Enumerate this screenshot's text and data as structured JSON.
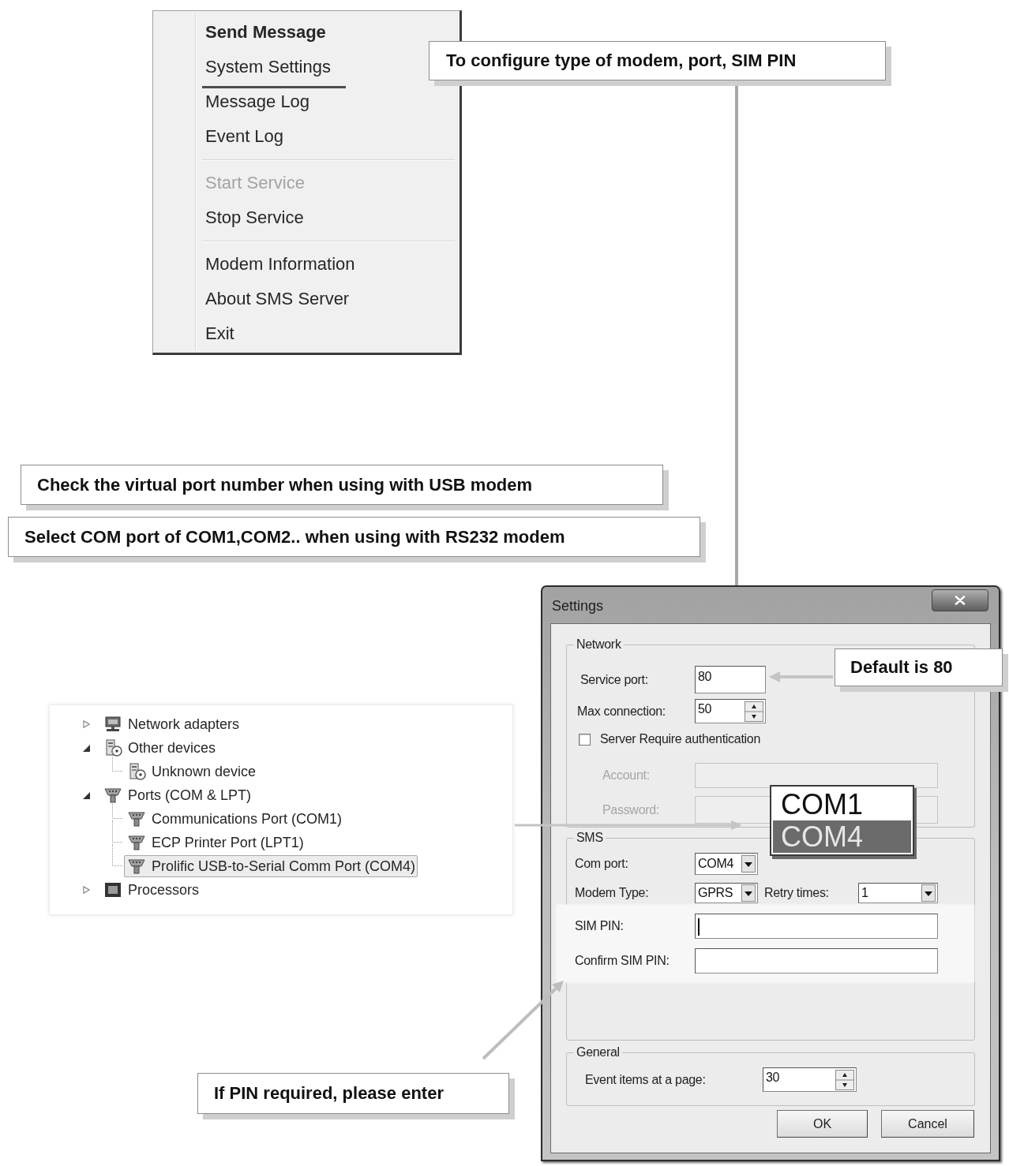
{
  "context_menu": {
    "groups": [
      {
        "items": [
          {
            "label": "Send Message",
            "default": true,
            "disabled": false,
            "underlined": false
          },
          {
            "label": "System Settings",
            "default": false,
            "disabled": false,
            "underlined": true
          },
          {
            "label": "Message Log",
            "default": false,
            "disabled": false,
            "underlined": false
          },
          {
            "label": "Event Log",
            "default": false,
            "disabled": false,
            "underlined": false
          }
        ]
      },
      {
        "items": [
          {
            "label": "Start Service",
            "default": false,
            "disabled": true,
            "underlined": false
          },
          {
            "label": "Stop Service",
            "default": false,
            "disabled": false,
            "underlined": false
          }
        ]
      },
      {
        "items": [
          {
            "label": "Modem Information",
            "default": false,
            "disabled": false,
            "underlined": false
          },
          {
            "label": "About SMS Server",
            "default": false,
            "disabled": false,
            "underlined": false
          },
          {
            "label": "Exit",
            "default": false,
            "disabled": false,
            "underlined": false
          }
        ]
      }
    ]
  },
  "callouts": [
    {
      "text": "To configure type of modem, port, SIM PIN"
    },
    {
      "text": "Check the virtual port number when using with USB modem"
    },
    {
      "text": "Select COM port of COM1,COM2.. when using with RS232 modem"
    },
    {
      "text": "Default is 80"
    },
    {
      "text": "If PIN required, please enter"
    }
  ],
  "device_tree": {
    "nodes": [
      {
        "label": "Network adapters",
        "kind": "network",
        "expanded": false,
        "selected": false
      },
      {
        "label": "Other devices",
        "kind": "unknown",
        "expanded": true,
        "selected": false,
        "children": [
          {
            "label": "Unknown device",
            "kind": "unknown",
            "selected": false
          }
        ]
      },
      {
        "label": "Ports (COM & LPT)",
        "kind": "port",
        "expanded": true,
        "selected": false,
        "children": [
          {
            "label": "Communications Port (COM1)",
            "kind": "port",
            "selected": false
          },
          {
            "label": "ECP Printer Port (LPT1)",
            "kind": "port",
            "selected": false
          },
          {
            "label": "Prolific USB-to-Serial Comm Port (COM4)",
            "kind": "port",
            "selected": true
          }
        ]
      },
      {
        "label": "Processors",
        "kind": "processor",
        "expanded": false,
        "selected": false
      }
    ]
  },
  "settings_dialog": {
    "title": "Settings",
    "network": {
      "legend": "Network",
      "service_port": {
        "label": "Service port:",
        "value": "80"
      },
      "max_connection": {
        "label": "Max connection:",
        "value": "50"
      },
      "require_authentication": {
        "label": "Server Require authentication",
        "checked": false
      },
      "account": {
        "label": "Account:",
        "disabled": true
      },
      "password": {
        "label": "Password:",
        "disabled": true
      }
    },
    "com_port_list": {
      "options": [
        {
          "label": "COM1",
          "selected": false
        },
        {
          "label": "COM4",
          "selected": true
        }
      ]
    },
    "sms": {
      "legend": "SMS",
      "com_port": {
        "label": "Com port:",
        "value": "COM4"
      },
      "modem_type": {
        "label": "Modem Type:",
        "value": "GPRS"
      },
      "retry_times": {
        "label": "Retry times:",
        "value": "1"
      },
      "pin_fields": {
        "highlighted": true,
        "sim_pin": {
          "label": "SIM PIN:",
          "focused": true
        },
        "confirm_sim_pin": {
          "label": "Confirm SIM PIN:",
          "focused": false
        }
      }
    },
    "general": {
      "legend": "General",
      "event_items": {
        "label": "Event items at a page:",
        "value": "30"
      }
    },
    "buttons": [
      {
        "label": "OK"
      },
      {
        "label": "Cancel"
      }
    ]
  }
}
